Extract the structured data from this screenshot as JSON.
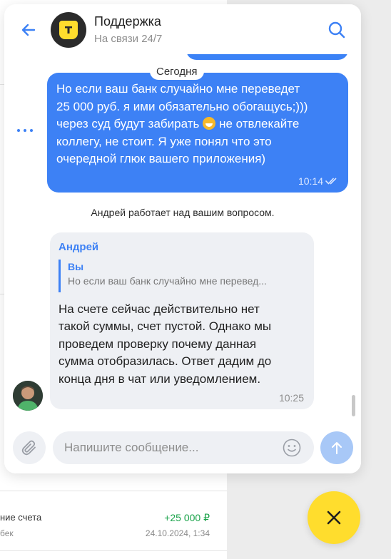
{
  "header": {
    "title": "Поддержка",
    "subtitle": "На связи 24/7"
  },
  "chat": {
    "date_label": "Сегодня",
    "outgoing": {
      "lines": [
        "Но если ваш банк случайно мне переведет",
        "25 000 руб. я ими обязательно обогащусь;)))",
        "через суд будут забирать",
        " не отвлекайте",
        "коллегу, не стоит. Я уже понял что это",
        "очередной глюк вашего приложения)"
      ],
      "time": "10:14",
      "status": "read"
    },
    "system_message": "Андрей работает над вашим вопросом.",
    "incoming": {
      "author": "Андрей",
      "reply_to": {
        "author": "Вы",
        "text": "Но если ваш банк случайно мне перевед..."
      },
      "lines": [
        "На счете сейчас действительно нет",
        "такой суммы, счет пустой. Однако мы",
        "проведем проверку почему данная",
        "сумма отобразилась. Ответ дадим до",
        "конца дня в чат или уведомлением."
      ],
      "time": "10:25"
    }
  },
  "composer": {
    "placeholder": "Напишите сообщение..."
  },
  "background": {
    "transaction": {
      "title_fragment": "ние счета",
      "subtitle_fragment": "бек",
      "amount": "+25 000 ₽",
      "date": "24.10.2024, 1:34"
    }
  },
  "icons": {
    "back": "arrow-left-icon",
    "search": "search-icon",
    "more": "more-dots-icon",
    "attach": "paperclip-icon",
    "emoji": "smiley-icon",
    "send": "arrow-up-icon",
    "close": "close-icon",
    "read": "double-check-icon"
  },
  "colors": {
    "accent": "#3d81f5",
    "brand_yellow": "#ffdd2d",
    "positive": "#1aa34a",
    "incoming_bubble": "#eef0f4"
  }
}
